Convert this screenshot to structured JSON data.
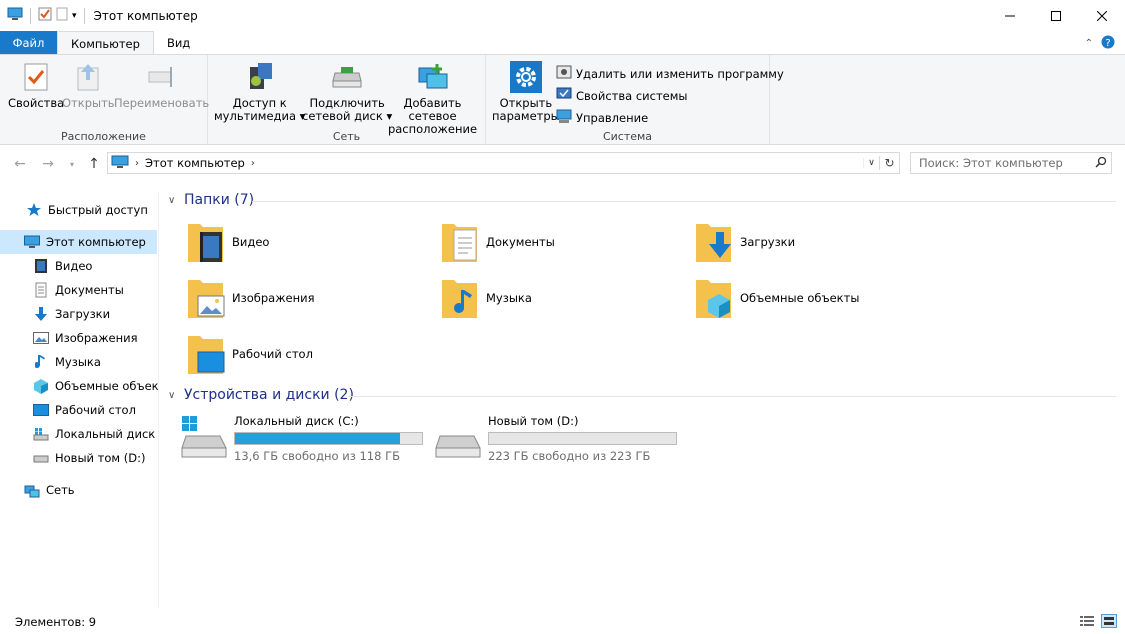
{
  "window": {
    "title": "Этот компьютер"
  },
  "ribbon_tabs": [
    {
      "label": "Файл"
    },
    {
      "label": "Компьютер"
    },
    {
      "label": "Вид"
    }
  ],
  "ribbon": {
    "location_group": {
      "label": "Расположение",
      "properties": "Свойства",
      "open": "Открыть",
      "rename": "Переименовать"
    },
    "network_group": {
      "label": "Сеть",
      "media_access_l1": "Доступ к",
      "media_access_l2": "мультимедиа",
      "map_drive_l1": "Подключить",
      "map_drive_l2": "сетевой диск",
      "add_location_l1": "Добавить сетевое",
      "add_location_l2": "расположение"
    },
    "system_group": {
      "label": "Система",
      "open_settings_l1": "Открыть",
      "open_settings_l2": "параметры",
      "uninstall": "Удалить или изменить программу",
      "system_properties": "Свойства системы",
      "manage": "Управление"
    }
  },
  "address": {
    "path": "Этот компьютер",
    "search_placeholder": "Поиск: Этот компьютер"
  },
  "sidebar": {
    "items": [
      {
        "label": "Быстрый доступ",
        "icon": "star-icon"
      },
      {
        "label": "Этот компьютер",
        "icon": "computer-icon"
      },
      {
        "label": "Видео",
        "icon": "video-icon"
      },
      {
        "label": "Документы",
        "icon": "documents-icon"
      },
      {
        "label": "Загрузки",
        "icon": "download-icon"
      },
      {
        "label": "Изображения",
        "icon": "pictures-icon"
      },
      {
        "label": "Музыка",
        "icon": "music-icon"
      },
      {
        "label": "Объемные объекты",
        "icon": "3d-objects-icon"
      },
      {
        "label": "Рабочий стол",
        "icon": "desktop-icon"
      },
      {
        "label": "Локальный диск (C:)",
        "icon": "drive-c-icon"
      },
      {
        "label": "Новый том (D:)",
        "icon": "drive-d-icon"
      },
      {
        "label": "Сеть",
        "icon": "network-icon"
      }
    ]
  },
  "folders_section": {
    "title": "Папки (7)",
    "items": [
      {
        "label": "Видео"
      },
      {
        "label": "Документы"
      },
      {
        "label": "Загрузки"
      },
      {
        "label": "Изображения"
      },
      {
        "label": "Музыка"
      },
      {
        "label": "Объемные объекты"
      },
      {
        "label": "Рабочий стол"
      }
    ]
  },
  "drives_section": {
    "title": "Устройства и диски (2)",
    "items": [
      {
        "label": "Локальный диск (C:)",
        "free": "13,6 ГБ свободно из 118 ГБ",
        "used_fraction": 0.885
      },
      {
        "label": "Новый том (D:)",
        "free": "223 ГБ свободно из 223 ГБ",
        "used_fraction": 0.0
      }
    ]
  },
  "status": {
    "items_count": "Элементов: 9"
  },
  "colors": {
    "accent": "#1979ca",
    "selection": "#cce8ff",
    "drive_bar": "#26a0da",
    "section_header": "#1e3287"
  }
}
